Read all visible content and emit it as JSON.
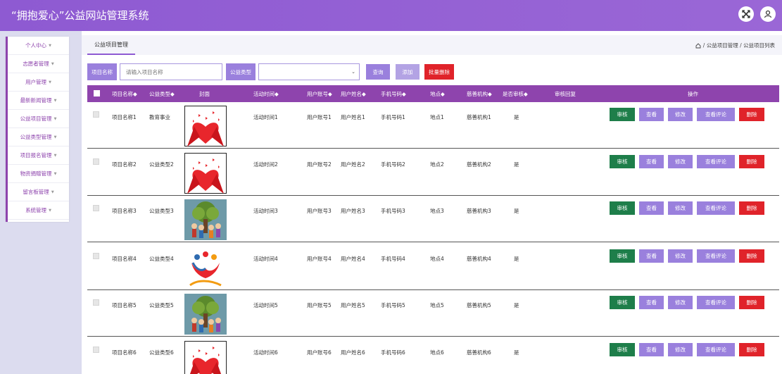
{
  "header": {
    "title": "“拥抱爱心”公益网站管理系统"
  },
  "sidebar": {
    "items": [
      {
        "label": "个人中心"
      },
      {
        "label": "志愿者管理"
      },
      {
        "label": "用户管理"
      },
      {
        "label": "最新新闻管理"
      },
      {
        "label": "公益项目管理"
      },
      {
        "label": "公益类型管理"
      },
      {
        "label": "项目报名管理"
      },
      {
        "label": "物资捐赠管理"
      },
      {
        "label": "留言板管理"
      },
      {
        "label": "系统管理"
      }
    ]
  },
  "breadcrumb": {
    "tab": "公益项目管理",
    "path": "/ 公益项目管理 / 公益项目列表"
  },
  "filter": {
    "name_label": "项目名称",
    "name_placeholder": "请输入项目名称",
    "type_label": "公益类型",
    "type_value": "",
    "search_label": "查询",
    "add_label": "添加",
    "batch_delete_label": "批量删除"
  },
  "table": {
    "headers": {
      "name": "项目名称◆",
      "type": "公益类型◆",
      "cover": "封面",
      "time": "活动时间◆",
      "account": "用户账号◆",
      "username": "用户姓名◆",
      "phone": "手机号码◆",
      "place": "地点◆",
      "org": "慈善机构◆",
      "approved": "是否审核◆",
      "reply": "审核回复",
      "ops": "操作"
    },
    "rows": [
      {
        "name": "项目名称1",
        "type": "教育事业",
        "time": "活动时间1",
        "account": "用户账号1",
        "username": "用户姓名1",
        "phone": "手机号码1",
        "place": "地点1",
        "org": "慈善机构1",
        "approved": "是",
        "reply": "",
        "cover": "hands-heart"
      },
      {
        "name": "项目名称2",
        "type": "公益类型2",
        "time": "活动时间2",
        "account": "用户账号2",
        "username": "用户姓名2",
        "phone": "手机号码2",
        "place": "地点2",
        "org": "慈善机构2",
        "approved": "是",
        "reply": "",
        "cover": "hands-heart"
      },
      {
        "name": "项目名称3",
        "type": "公益类型3",
        "time": "活动时间3",
        "account": "用户账号3",
        "username": "用户姓名3",
        "phone": "手机号码3",
        "place": "地点3",
        "org": "慈善机构3",
        "approved": "是",
        "reply": "",
        "cover": "tree-people"
      },
      {
        "name": "项目名称4",
        "type": "公益类型4",
        "time": "活动时间4",
        "account": "用户账号4",
        "username": "用户姓名4",
        "phone": "手机号码4",
        "place": "地点4",
        "org": "慈善机构4",
        "approved": "是",
        "reply": "",
        "cover": "love-logo"
      },
      {
        "name": "项目名称5",
        "type": "公益类型5",
        "time": "活动时间5",
        "account": "用户账号5",
        "username": "用户姓名5",
        "phone": "手机号码5",
        "place": "地点5",
        "org": "慈善机构5",
        "approved": "是",
        "reply": "",
        "cover": "tree-people"
      },
      {
        "name": "项目名称6",
        "type": "公益类型6",
        "time": "活动时间6",
        "account": "用户账号6",
        "username": "用户姓名6",
        "phone": "手机号码6",
        "place": "地点6",
        "org": "慈善机构6",
        "approved": "是",
        "reply": "",
        "cover": "hands-heart"
      }
    ],
    "ops": {
      "audit": "审核",
      "view": "查看",
      "edit": "修改",
      "comments": "查看评论",
      "delete": "删除"
    }
  },
  "colors": {
    "header": "#8e5ad2",
    "table_head": "#8e44ad",
    "audit": "#1e7e4a",
    "action": "#9a80dd",
    "delete": "#e0232a"
  }
}
